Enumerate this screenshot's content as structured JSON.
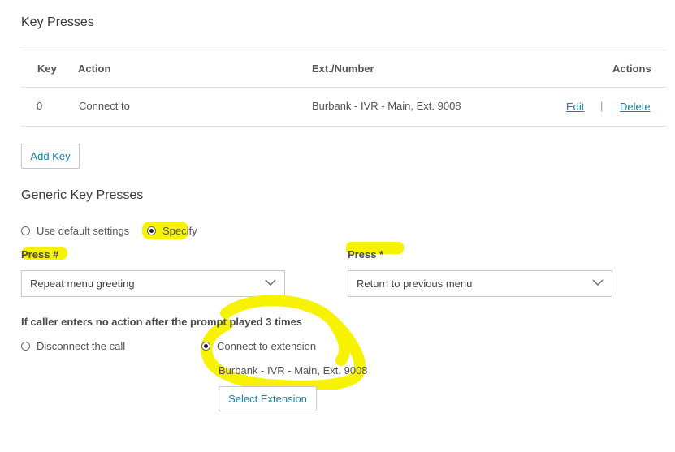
{
  "key_presses": {
    "title": "Key Presses",
    "columns": {
      "key": "Key",
      "action": "Action",
      "ext": "Ext./Number",
      "actions": "Actions"
    },
    "rows": [
      {
        "key": "0",
        "action": "Connect to",
        "ext": "Burbank - IVR - Main, Ext. 9008",
        "edit": "Edit",
        "sep": "|",
        "delete": "Delete"
      }
    ],
    "add_key": "Add Key"
  },
  "generic": {
    "title": "Generic Key Presses",
    "options": {
      "default": "Use default settings",
      "specify": "Specify"
    },
    "selected": "specify",
    "press_hash": {
      "label": "Press #",
      "value": "Repeat menu greeting"
    },
    "press_star": {
      "label": "Press *",
      "value": "Return to previous menu"
    },
    "no_action": {
      "label": "If caller enters no action after the prompt played 3 times",
      "disconnect": "Disconnect the call",
      "connect": "Connect to extension",
      "selected": "connect",
      "extension": "Burbank - IVR - Main, Ext. 9008",
      "select_button": "Select Extension"
    }
  },
  "colors": {
    "link": "#1a7fa8",
    "highlight": "#f7f300",
    "border": "#c8c8c8"
  }
}
